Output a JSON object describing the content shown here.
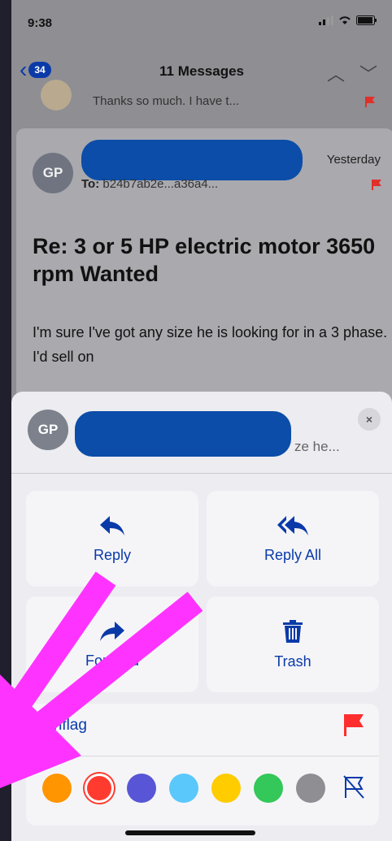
{
  "status_bar": {
    "time": "9:38",
    "icons": "signal wifi battery"
  },
  "nav": {
    "back_badge": "34",
    "title": "11 Messages"
  },
  "previous_message": {
    "preview": "Thanks so much. I have t..."
  },
  "message": {
    "avatar_initials": "GP",
    "date": "Yesterday",
    "to_label": "To:",
    "to_value": "b24b7ab2e...a36a4...",
    "subject": "Re:  3 or 5 HP electric motor 3650 rpm Wanted",
    "body": "I'm sure I've got any size he is looking for in a 3 phase. I'd sell on"
  },
  "sheet": {
    "avatar_initials": "GP",
    "preview": "ze he...",
    "close_label": "×",
    "actions": {
      "reply": "Reply",
      "reply_all": "Reply All",
      "forward": "Forward",
      "trash": "Trash"
    },
    "unflag_label": "Unflag",
    "flag_colors": [
      {
        "name": "orange",
        "hex": "#ff9500"
      },
      {
        "name": "red",
        "hex": "#ff3b30",
        "selected": true
      },
      {
        "name": "purple",
        "hex": "#5856d6"
      },
      {
        "name": "blue",
        "hex": "#5ac8fa"
      },
      {
        "name": "yellow",
        "hex": "#ffcc00"
      },
      {
        "name": "green",
        "hex": "#34c759"
      },
      {
        "name": "gray",
        "hex": "#8e8e93"
      }
    ]
  },
  "colors": {
    "accent": "#0a3aa8",
    "flag": "#ff2d2d",
    "annotation_arrow": "#ff33ff",
    "redaction": "#0b4da8"
  }
}
